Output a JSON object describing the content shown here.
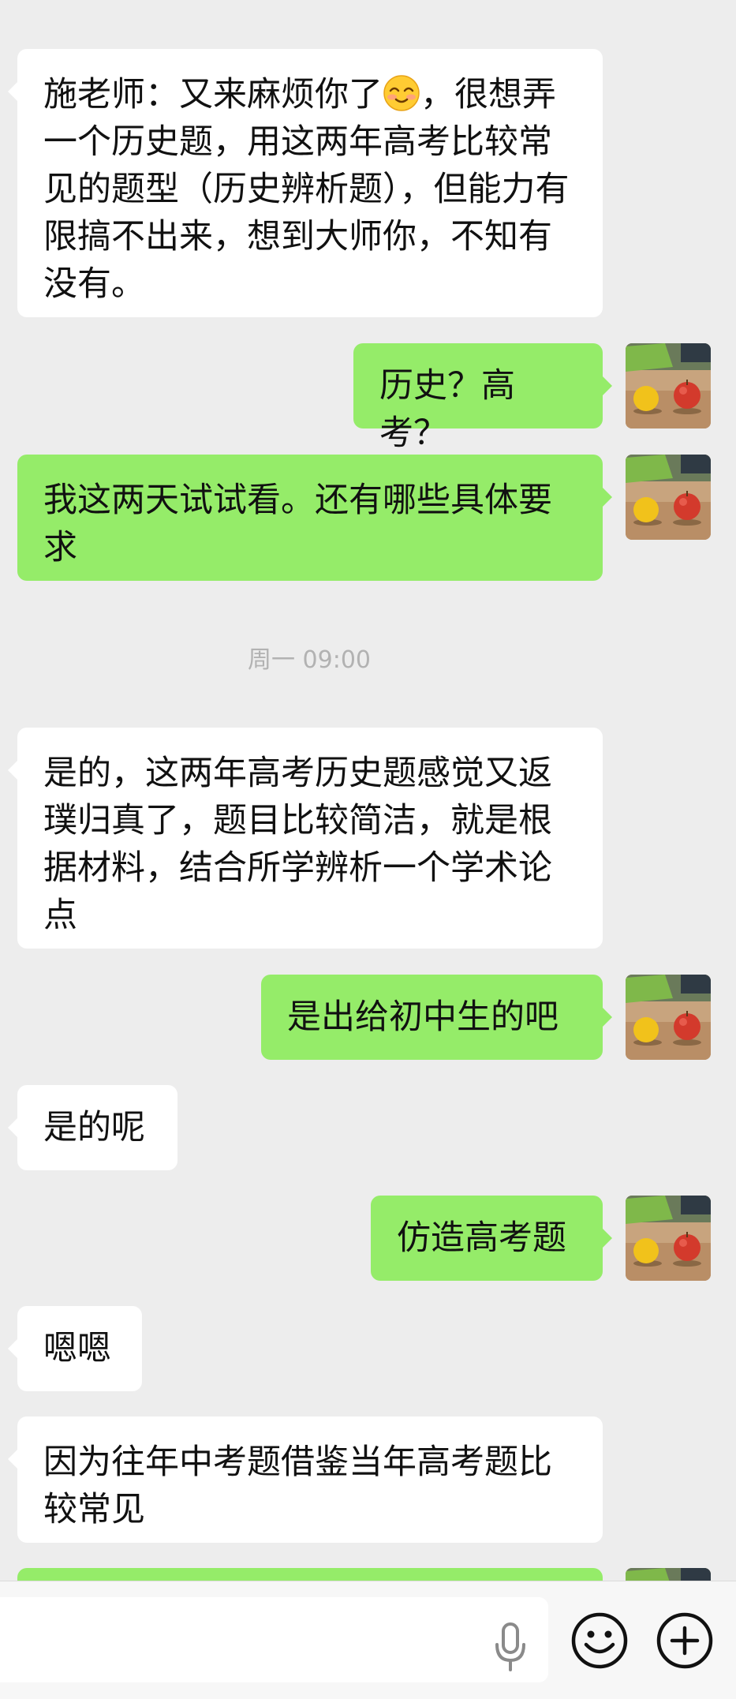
{
  "messages": [
    {
      "from": "other",
      "before_emoji": "施老师：又来麻烦你了",
      "emoji": "smiling-face-with-smiling-eyes",
      "after_emoji": "，很想弄一个历史题，用这两年高考比较常见的题型（历史辨析题），但能力有限搞不出来，想到大师你，不知有没有。"
    },
    {
      "from": "self",
      "text": "历史？高考？"
    },
    {
      "from": "self",
      "text": "我这两天试试看。还有哪些具体要求"
    },
    {
      "from": "other",
      "text": "是的，这两年高考历史题感觉又返璞归真了，题目比较简洁，就是根据材料，结合所学辨析一个学术论点"
    },
    {
      "from": "self",
      "text": "是出给初中生的吧"
    },
    {
      "from": "other",
      "text": "是的呢"
    },
    {
      "from": "self",
      "text": "仿造高考题"
    },
    {
      "from": "other",
      "text": "嗯嗯"
    },
    {
      "from": "other",
      "text": "因为往年中考题借鉴当年高考题比较常见"
    }
  ],
  "timestamp": "周一 09:00",
  "colors": {
    "background": "#ededed",
    "incoming_bubble": "#ffffff",
    "outgoing_bubble": "#95ec69",
    "timestamp_text": "#b2b2b2"
  },
  "input_bar": {
    "icons": [
      "microphone-icon",
      "emoji-icon",
      "plus-icon"
    ]
  }
}
